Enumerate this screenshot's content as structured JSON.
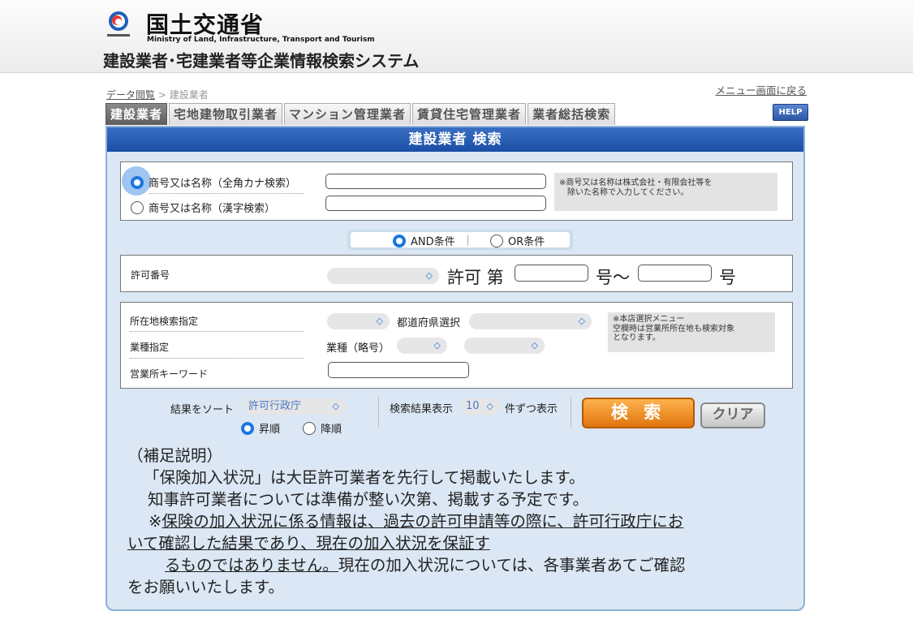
{
  "header": {
    "ministry_jp": "国土交通省",
    "ministry_en": "Ministry of Land, Infrastructure, Transport and Tourism",
    "system_title": "建設業者･宅建業者等企業情報検索システム"
  },
  "breadcrumb": {
    "link": "データ閲覧",
    "separator": " > ",
    "current": "建設業者"
  },
  "menu_return": "メニュー画面に戻る",
  "tabs": [
    "建設業者",
    "宅地建物取引業者",
    "マンション管理業者",
    "賃貸住宅管理業者",
    "業者総括検索"
  ],
  "help": "HELP",
  "panel_title": "建設業者 検索",
  "name_search": {
    "option_kana": "商号又は名称（全角カナ検索）",
    "option_kanji": "商号又は名称（漢字検索）",
    "selected": "kana",
    "kana_value": "",
    "kanji_value": "",
    "note_line1": "※商号又は名称は株式会社・有限会社等を",
    "note_line2": "除いた名称で入力してください。"
  },
  "condition": {
    "and_label": "AND条件",
    "or_label": "OR条件",
    "selected": "AND"
  },
  "permit": {
    "label": "許可番号",
    "select_value": "",
    "prefix": "許可 第",
    "mid": "号～",
    "suffix": "号",
    "from_value": "",
    "to_value": ""
  },
  "location": {
    "label": "所在地検索指定",
    "select_value": "",
    "prefecture_label": "都道府県選択",
    "prefecture_value": "",
    "industry_label": "業種指定",
    "industry_abbr_label": "業種（略号）",
    "industry_value1": "",
    "industry_value2": "",
    "keyword_label": "営業所キーワード",
    "keyword_value": "",
    "note_line1": "※本店選択メニュー",
    "note_line2": "空欄時は営業所所在地も検索対象",
    "note_line3": "となります。"
  },
  "sort": {
    "label": "結果をソート",
    "value": "許可行政庁",
    "asc": "昇順",
    "desc": "降順",
    "selected": "asc"
  },
  "display": {
    "prefix": "検索結果表示",
    "value": "10",
    "suffix": "件ずつ表示"
  },
  "buttons": {
    "search": "検 索",
    "clear": "クリア"
  },
  "supplement": {
    "heading": "（補足説明）",
    "line1": "「保険加入状況」は大臣許可業者を先行して掲載いたします。",
    "line2": "知事許可業者については準備が整い次第、掲載する予定です。",
    "line3_mark": "※",
    "line3_underlined": "保険の加入状況に係る情報は、過去の許可申請等の際に、許可行政庁にお",
    "line4_underlined": "いて確認した結果であり、現在の加入状況を保証す",
    "line5_underlined": "るものではありません。",
    "line5_rest": "現在の加入状況については、各事業者あてご確認",
    "line6": "をお願いいたします。"
  }
}
